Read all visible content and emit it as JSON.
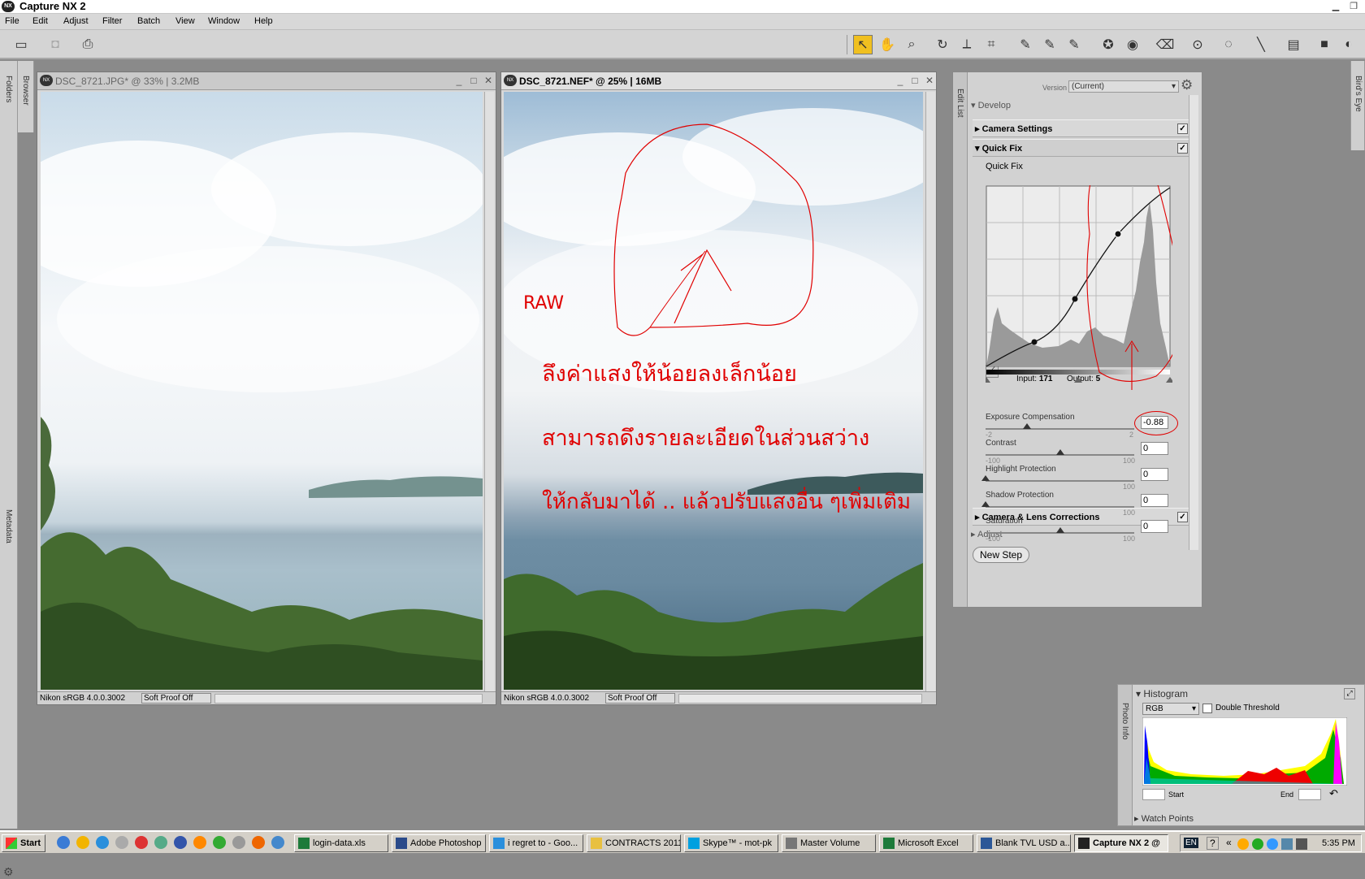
{
  "app": {
    "title": "Capture NX 2",
    "icon": "NX"
  },
  "menu": [
    "File",
    "Edit",
    "Adjust",
    "Filter",
    "Batch",
    "View",
    "Window",
    "Help"
  ],
  "left_strip": {
    "folders": "Folders",
    "browser": "Browser",
    "metadata": "Metadata"
  },
  "right_strip": {
    "birds_eye": "Bird's Eye"
  },
  "doc1": {
    "title": "DSC_8721.JPG* @ 33% | 3.2MB",
    "profile": "Nikon sRGB 4.0.0.3002",
    "soft_proof": "Soft Proof Off"
  },
  "doc2": {
    "title": "DSC_8721.NEF* @ 25% | 16MB",
    "profile": "Nikon sRGB 4.0.0.3002",
    "soft_proof": "Soft Proof Off"
  },
  "annotations": {
    "raw": "RAW",
    "line1": "ลึงค่าแสงให้น้อยลงเล็กน้อย",
    "line2": "สามารถดึงรายละเอียดในส่วนสว่าง",
    "line3": "ให้กลับมาได้ .. แล้วปรับแสงอื่น ๆเพิ่มเติม"
  },
  "edit_list": {
    "tab": "Edit List",
    "version_label": "Version",
    "version_value": "(Current)",
    "develop": "Develop",
    "camera_settings": "Camera Settings",
    "quick_fix": "Quick Fix",
    "quick_fix_sub": "Quick Fix",
    "input_label": "Input:",
    "input_value": "171",
    "output_label": "Output:",
    "output_value": "5",
    "camera_lens": "Camera & Lens Corrections",
    "adjust": "Adjust",
    "new_step": "New Step",
    "sliders": [
      {
        "label": "Exposure Compensation",
        "min": "-2",
        "max": "2",
        "value": "-0.88",
        "level": -0.88
      },
      {
        "label": "Contrast",
        "min": "-100",
        "max": "100",
        "value": "0",
        "level": 0
      },
      {
        "label": "Highlight Protection",
        "min": "",
        "max": "100",
        "value": "0",
        "level": 0
      },
      {
        "label": "Shadow Protection",
        "min": "",
        "max": "100",
        "value": "0",
        "level": 0
      },
      {
        "label": "Saturation",
        "min": "-100",
        "max": "100",
        "value": "0",
        "level": 0
      }
    ]
  },
  "histogram_panel": {
    "title": "Histogram",
    "channel": "RGB",
    "double_threshold": "Double Threshold",
    "start_label": "Start",
    "end_label": "End",
    "side_tab": "Photo Info",
    "watch_points": "Watch Points"
  },
  "taskbar": {
    "start": "Start",
    "items": [
      {
        "label": "login-data.xls",
        "icon": "excel-icon"
      },
      {
        "label": "Adobe Photoshop",
        "icon": "photoshop-icon"
      },
      {
        "label": "i regret to - Goo...",
        "icon": "ie-icon"
      },
      {
        "label": "CONTRACTS 2011",
        "icon": "folder-icon"
      },
      {
        "label": "Skype™ - mot-pk",
        "icon": "skype-icon"
      },
      {
        "label": "Master Volume",
        "icon": "volume-icon"
      },
      {
        "label": "Microsoft Excel",
        "icon": "excel-icon"
      },
      {
        "label": "Blank TVL USD a...",
        "icon": "word-icon"
      },
      {
        "label": "Capture NX 2 @",
        "icon": "nx-icon"
      }
    ],
    "lang": "EN",
    "help": "?",
    "clock": "5:35 PM"
  },
  "colors": {
    "accent": "#f0c020",
    "annotation": "#e00000"
  }
}
